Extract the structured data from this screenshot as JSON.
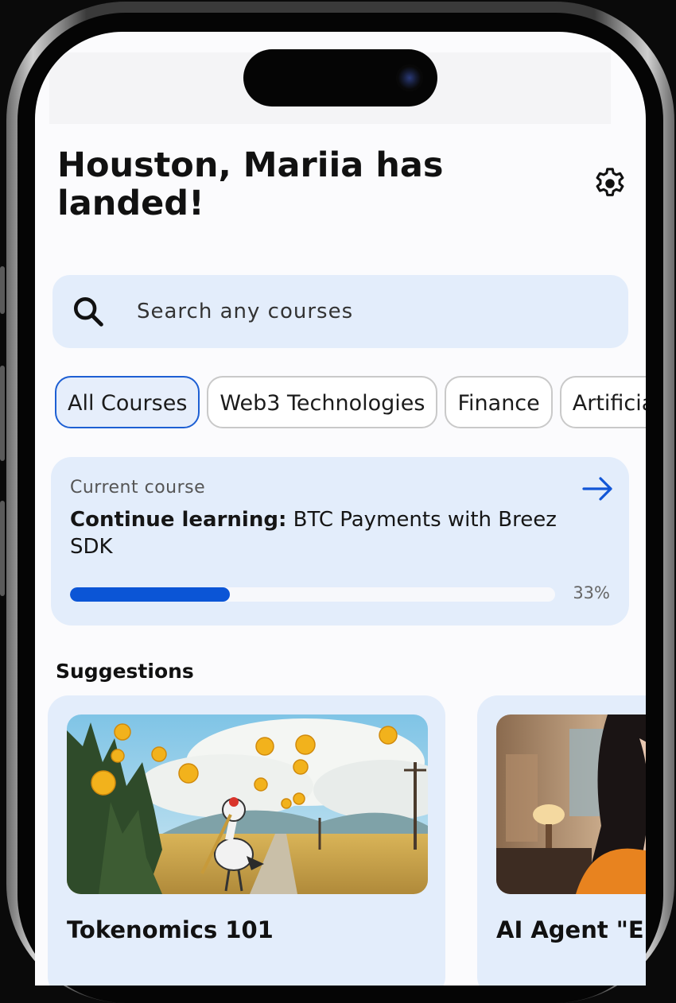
{
  "header": {
    "title": "Houston, Mariia has landed!"
  },
  "search": {
    "placeholder": "Search any courses"
  },
  "filters": [
    {
      "label": "All Courses",
      "active": true
    },
    {
      "label": "Web3 Technologies",
      "active": false
    },
    {
      "label": "Finance",
      "active": false
    },
    {
      "label": "Artificial Intelligence",
      "active": false
    }
  ],
  "current_course": {
    "label": "Current course",
    "prefix": "Continue learning:",
    "title": "BTC Payments with Breez SDK",
    "progress": 0.33,
    "progress_text": "33%"
  },
  "suggestions": {
    "heading": "Suggestions",
    "items": [
      {
        "title": "Tokenomics 101"
      },
      {
        "title": "AI Agent \"E"
      }
    ]
  },
  "colors": {
    "accent": "#0b55d6",
    "card_bg": "#e3edfb",
    "chip_active_border": "#1d5fd3"
  },
  "icons": {
    "settings": "gear-icon",
    "search": "search-icon",
    "arrow": "arrow-right-icon"
  }
}
